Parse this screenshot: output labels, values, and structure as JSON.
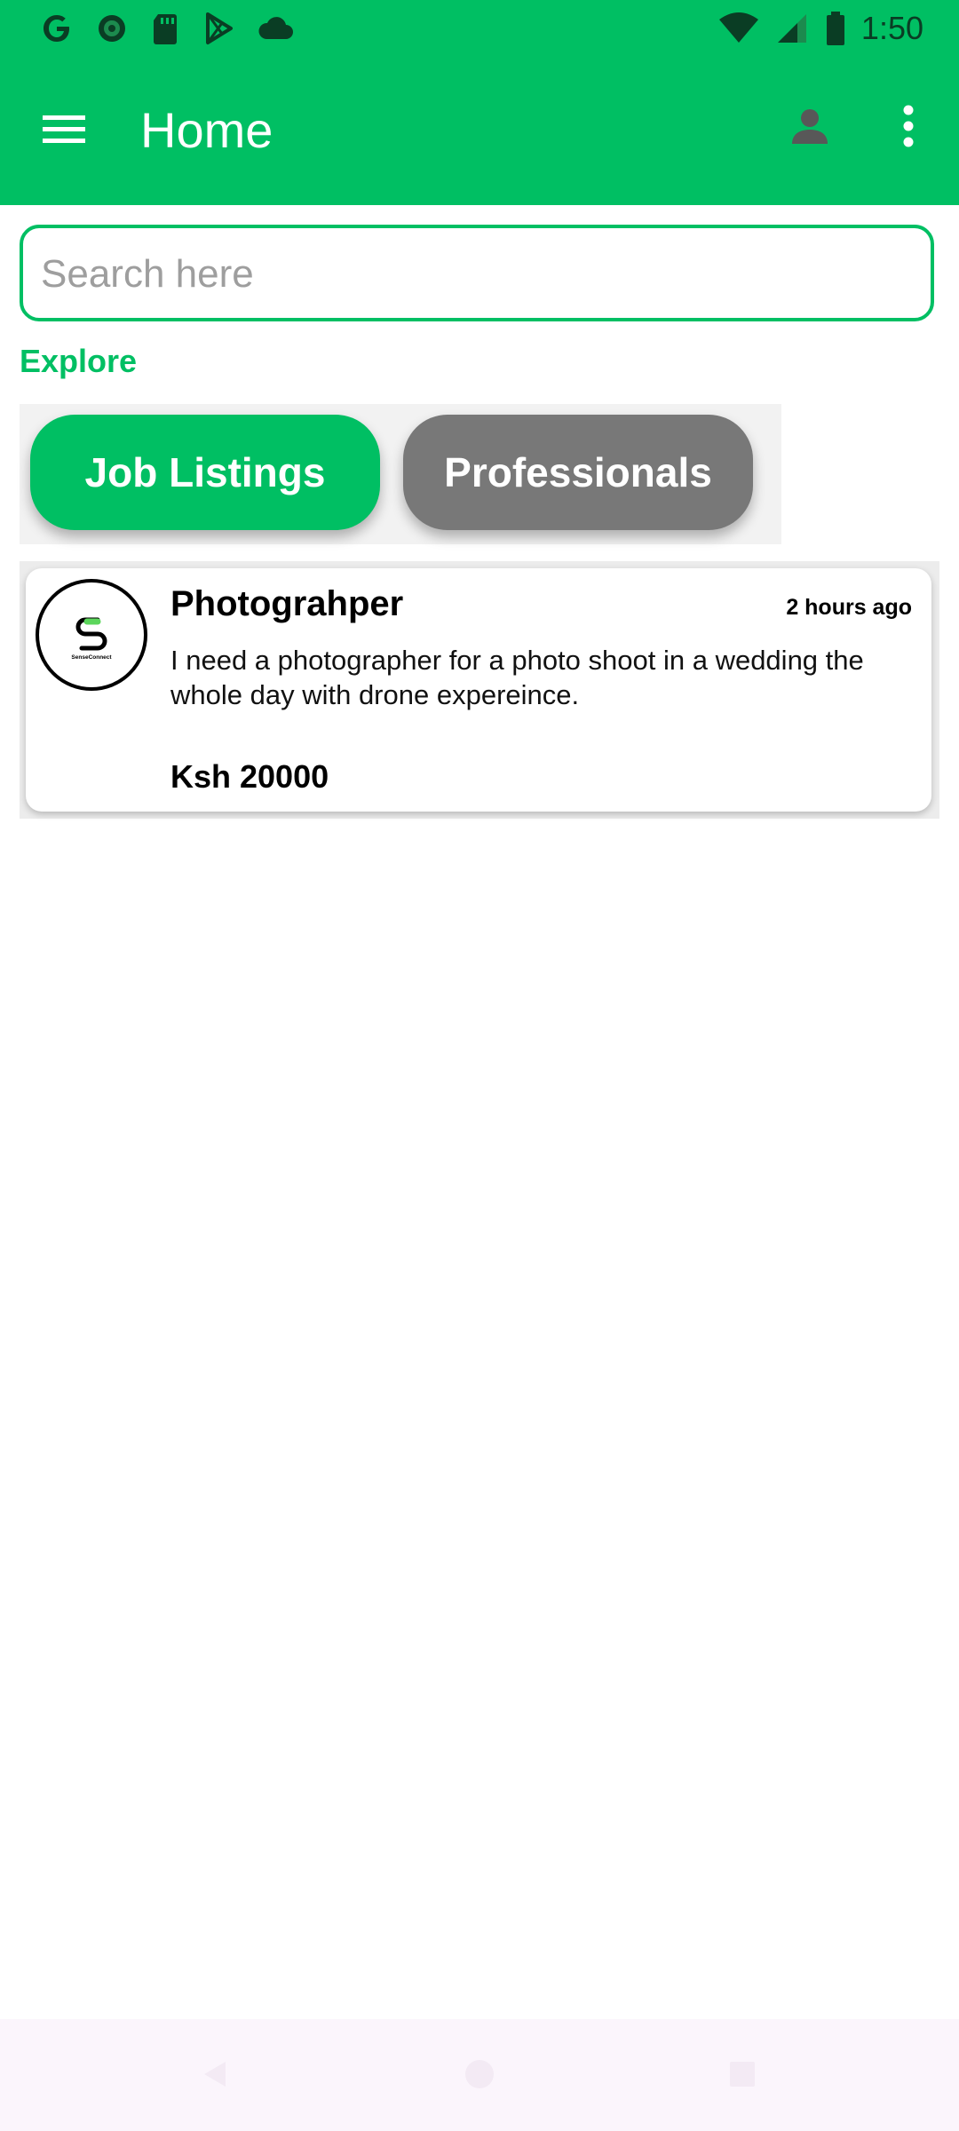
{
  "status_bar": {
    "time": "1:50",
    "left_icons": [
      "google-icon",
      "photos-icon",
      "sd-card-icon",
      "play-store-icon",
      "cloud-icon"
    ],
    "right_icons": [
      "wifi-icon",
      "cell-signal-icon",
      "battery-icon"
    ]
  },
  "app_bar": {
    "title": "Home",
    "icons": [
      "menu-icon",
      "person-icon",
      "more-vert-icon"
    ]
  },
  "search": {
    "placeholder": "Search here",
    "value": ""
  },
  "explore": {
    "label": "Explore",
    "tabs": [
      {
        "label": "Job Listings",
        "selected": true
      },
      {
        "label": "Professionals",
        "selected": false
      }
    ]
  },
  "jobs": [
    {
      "title": "Photograhper",
      "time": "2 hours ago",
      "description": "I need  a photographer for a photo shoot in a wedding the whole day with drone expereince.",
      "price": "Ksh 20000",
      "logo_text": "SenseConnect"
    }
  ],
  "colors": {
    "primary": "#00bf63",
    "tab_inactive": "#787878",
    "nav_bar": "#fbf5fc",
    "status_icons": "#0a3d24"
  },
  "nav_bar": {
    "icons": [
      "back-icon",
      "home-icon",
      "recents-icon"
    ]
  }
}
